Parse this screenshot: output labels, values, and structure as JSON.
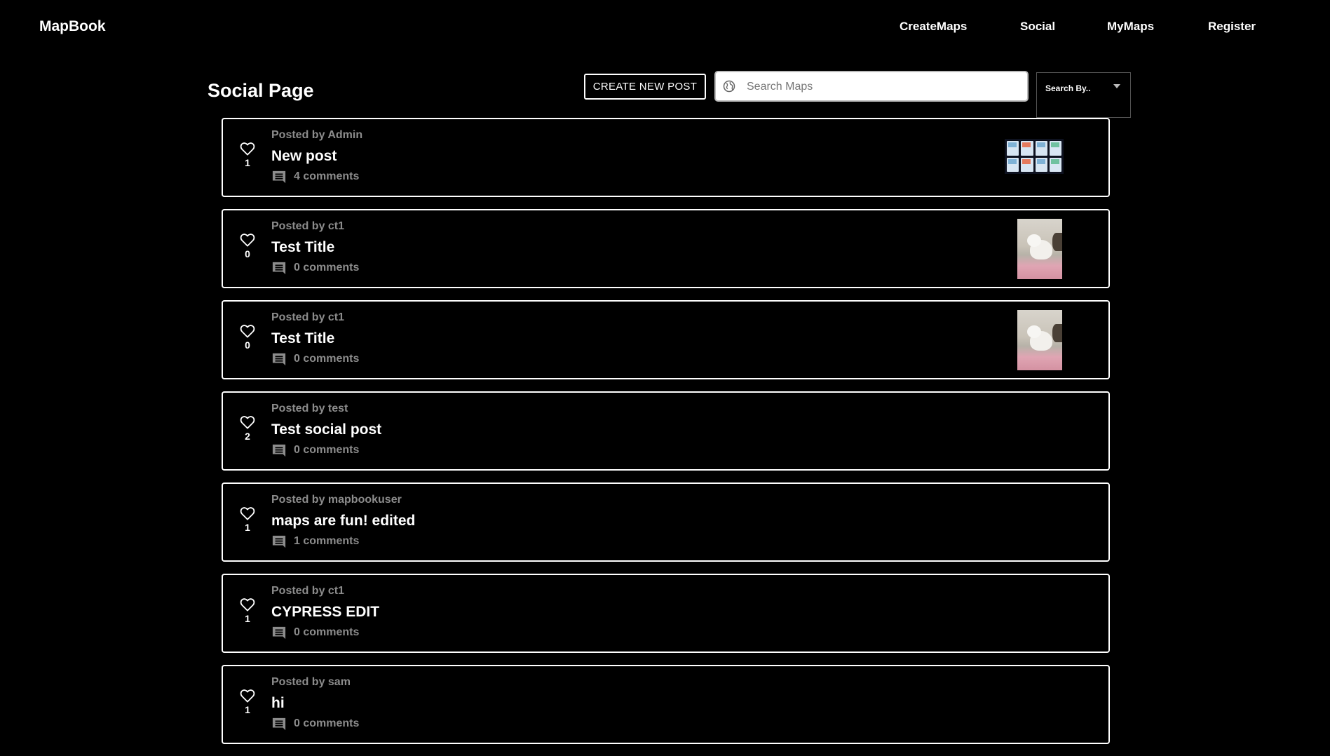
{
  "nav": {
    "brand": "MapBook",
    "links": [
      "CreateMaps",
      "Social",
      "MyMaps",
      "Register"
    ]
  },
  "header": {
    "title": "Social Page",
    "create_button": "CREATE NEW POST",
    "search_placeholder": "Search Maps",
    "search_value": "",
    "search_by_label": "Search By.."
  },
  "posts": [
    {
      "posted_by": "Posted by Admin",
      "title": "New post",
      "likes": "1",
      "comments": "4 comments",
      "thumbnail": "map-grid"
    },
    {
      "posted_by": "Posted by ct1",
      "title": "Test Title",
      "likes": "0",
      "comments": "0 comments",
      "thumbnail": "dog-photo"
    },
    {
      "posted_by": "Posted by ct1",
      "title": "Test Title",
      "likes": "0",
      "comments": "0 comments",
      "thumbnail": "dog-photo"
    },
    {
      "posted_by": "Posted by test",
      "title": "Test social post",
      "likes": "2",
      "comments": "0 comments",
      "thumbnail": ""
    },
    {
      "posted_by": "Posted by mapbookuser",
      "title": "maps are fun! edited",
      "likes": "1",
      "comments": "1 comments",
      "thumbnail": ""
    },
    {
      "posted_by": "Posted by ct1",
      "title": "CYPRESS EDIT",
      "likes": "1",
      "comments": "0 comments",
      "thumbnail": ""
    },
    {
      "posted_by": "Posted by sam",
      "title": "hi",
      "likes": "1",
      "comments": "0 comments",
      "thumbnail": ""
    }
  ],
  "icons": {
    "like": "heart-outline-icon",
    "comments": "comment-icon",
    "search": "globe-icon",
    "dropdown": "caret-down-icon"
  },
  "colors": {
    "background": "#000000",
    "text": "#ffffff",
    "muted": "#8c8c8c"
  }
}
